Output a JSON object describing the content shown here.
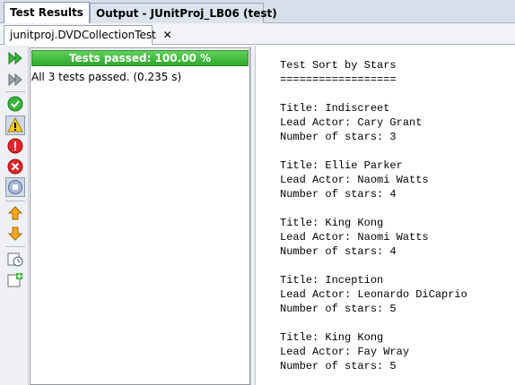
{
  "tabs": {
    "test_results": "Test Results",
    "output": "Output - JUnitProj_LB06 (test)",
    "close_glyph": "✕"
  },
  "subtab": {
    "label": "junitproj.DVDCollectionTest",
    "close_glyph": "✕"
  },
  "toolbar": {
    "icons": [
      "rerun-icon",
      "rerun-failed-icon",
      "show-passed-icon",
      "show-warnings-icon",
      "show-failures-icon",
      "show-errors-icon",
      "show-aborted-icon",
      "previous-failure-icon",
      "next-failure-icon",
      "sort-by-time-icon",
      "add-test-icon"
    ]
  },
  "results": {
    "progress_label": "Tests passed: 100.00 %",
    "progress_fraction": 1.0,
    "summary": "All 3 tests passed. (0.235 s)"
  },
  "output": {
    "lines": [
      "Test Sort by Stars",
      "==================",
      "",
      "Title: Indiscreet",
      "Lead Actor: Cary Grant",
      "Number of stars: 3",
      "",
      "Title: Ellie Parker",
      "Lead Actor: Naomi Watts",
      "Number of stars: 4",
      "",
      "Title: King Kong",
      "Lead Actor: Naomi Watts",
      "Number of stars: 4",
      "",
      "Title: Inception",
      "Lead Actor: Leonardo DiCaprio",
      "Number of stars: 5",
      "",
      "Title: King Kong",
      "Lead Actor: Fay Wray",
      "Number of stars: 5"
    ]
  },
  "colors": {
    "progress_green": "#2fa82c",
    "tab_bar": "#d9dfea"
  }
}
